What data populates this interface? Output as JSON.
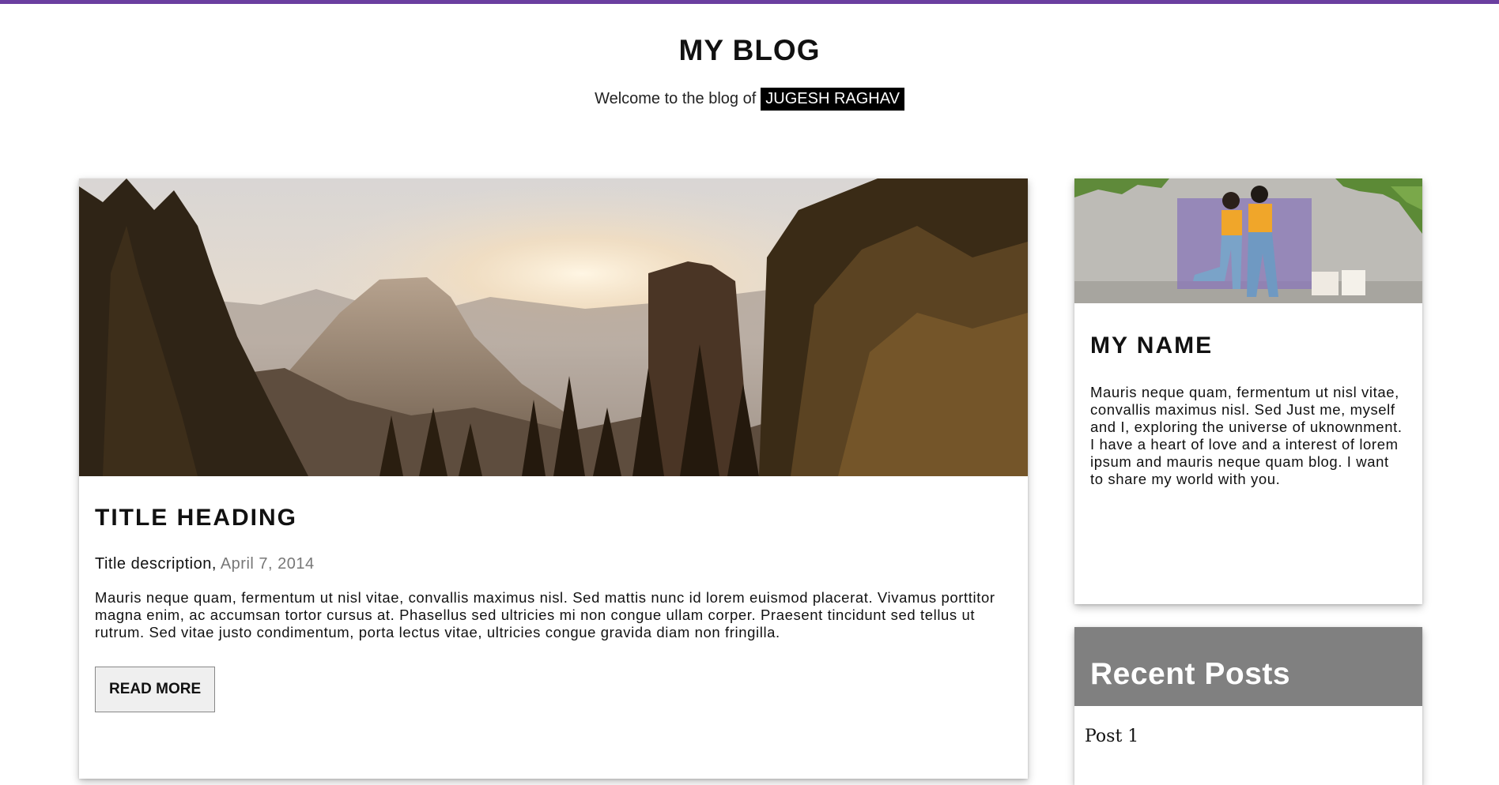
{
  "header": {
    "title": "MY BLOG",
    "welcome": "Welcome to the blog of",
    "author": "JUGESH RAGHAV"
  },
  "post": {
    "hero_image": "mountain sunset forest image",
    "title": "TITLE HEADING",
    "description": "Title description,",
    "date": "April 7, 2014",
    "body": "Mauris neque quam, fermentum ut nisl vitae, convallis maximus nisl. Sed mattis nunc id lorem euismod placerat. Vivamus porttitor magna enim, ac accumsan tortor cursus at. Phasellus sed ultricies mi non congue ullam corper. Praesent tincidunt sed tellus ut rutrum. Sed vitae justo condimentum, porta lectus vitae, ultricies congue gravida diam non fringilla.",
    "read_more": "READ MORE"
  },
  "about": {
    "photo": "couple photo against wall",
    "title": "MY NAME",
    "text": "Mauris neque quam, fermentum ut nisl vitae, convallis maximus nisl. Sed Just me, myself and I, exploring the universe of uknownment. I have a heart of love and a interest of lorem ipsum and mauris neque quam blog. I want to share my world with you."
  },
  "recent": {
    "title": "Recent Posts",
    "items": [
      "Post 1"
    ]
  },
  "colors": {
    "accent": "#6b3fa0",
    "recent_header": "#808080"
  }
}
